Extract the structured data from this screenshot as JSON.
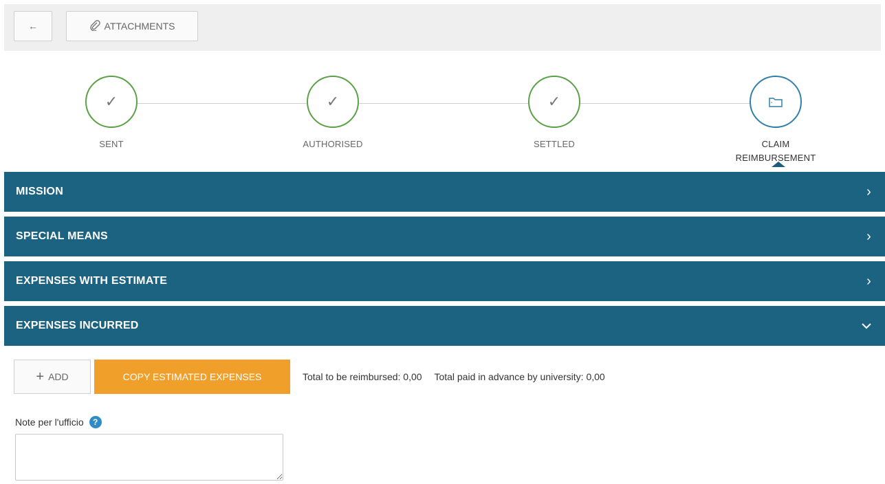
{
  "toolbar": {
    "back_icon": "←",
    "attachments_icon": "paperclip-icon",
    "attachments_label": "ATTACHMENTS"
  },
  "stepper": {
    "steps": [
      {
        "label": "SENT",
        "state": "done",
        "icon": "check-icon"
      },
      {
        "label": "AUTHORISED",
        "state": "done",
        "icon": "check-icon"
      },
      {
        "label": "SETTLED",
        "state": "done",
        "icon": "check-icon"
      },
      {
        "label": "CLAIM REIMBURSEMENT",
        "state": "current",
        "icon": "folder-icon"
      }
    ],
    "done_color": "#5aa046",
    "current_color": "#2f7fa8"
  },
  "panels": [
    {
      "title": "MISSION",
      "expanded": false
    },
    {
      "title": "SPECIAL MEANS",
      "expanded": false
    },
    {
      "title": "EXPENSES WITH ESTIMATE",
      "expanded": false
    },
    {
      "title": "EXPENSES INCURRED",
      "expanded": true
    }
  ],
  "panel_color": "#1c6382",
  "expenses": {
    "add_label": "ADD",
    "copy_label": "COPY ESTIMATED EXPENSES",
    "copy_color": "#f0a02a",
    "total_reimbursed": "Total to be reimbursed: 0,00",
    "total_advance": "Total paid in advance by university: 0,00"
  },
  "note": {
    "label": "Note per l'ufficio",
    "help_icon": "?",
    "value": ""
  }
}
